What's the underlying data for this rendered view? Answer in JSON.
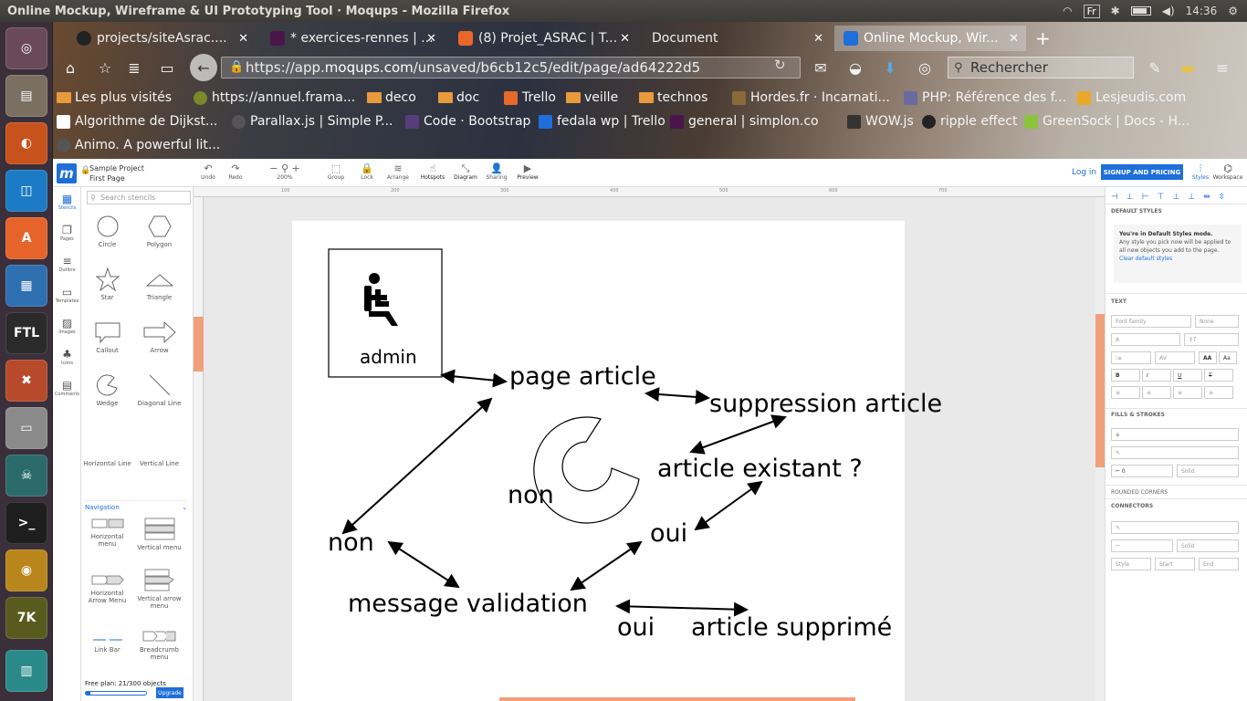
{
  "system": {
    "window_title": "Online Mockup, Wireframe & UI Prototyping Tool · Moqups - Mozilla Firefox",
    "keyboard": "Fr",
    "clock": "14:36"
  },
  "tabs": [
    {
      "label": "projects/siteAsrac...."
    },
    {
      "label": "* exercices-rennes | ..."
    },
    {
      "label": "(8) Projet_ASRAC | T..."
    },
    {
      "label": "Document"
    },
    {
      "label": "Online Mockup, Wir..."
    }
  ],
  "navbar": {
    "url_prefix": "https://app.",
    "url_domain": "moqups.com",
    "url_path": "/unsaved/b6cb12c5/edit/page/ad64222d5",
    "search_placeholder": "Rechercher"
  },
  "bookmarks_row1": [
    {
      "label": "Les plus visités"
    },
    {
      "label": "https://annuel.frama..."
    },
    {
      "label": "deco"
    },
    {
      "label": "doc"
    },
    {
      "label": "Trello"
    },
    {
      "label": "veille"
    },
    {
      "label": "technos"
    },
    {
      "label": "Hordes.fr · Incarnati..."
    },
    {
      "label": "PHP: Référence des f..."
    },
    {
      "label": "Lesjeudis.com"
    }
  ],
  "bookmarks_row2": [
    {
      "label": "Algorithme de Dijkst..."
    },
    {
      "label": "Parallax.js | Simple P..."
    },
    {
      "label": "Code · Bootstrap"
    },
    {
      "label": "fedala wp | Trello"
    },
    {
      "label": "general | simplon.co"
    },
    {
      "label": "WOW.js"
    },
    {
      "label": "ripple effect"
    },
    {
      "label": "GreenSock | Docs - H..."
    }
  ],
  "bookmarks_row3": [
    {
      "label": "Animo. A powerful lit..."
    }
  ],
  "app": {
    "project_name": "Sample Project",
    "page_name": "First Page",
    "tools": [
      "Undo",
      "Redo",
      "200%",
      "Group",
      "Lock",
      "Arrange",
      "Hotspots",
      "Diagram",
      "Sharing",
      "Preview"
    ],
    "login": "Log in",
    "signup": "SIGNUP AND PRICING",
    "right_tools": [
      "Styles",
      "Workspace"
    ],
    "side_icons": [
      "Stencils",
      "Pages",
      "Outline",
      "Templates",
      "Images",
      "Icons",
      "Comments"
    ],
    "stencil_search": "Search stencils",
    "stencils": [
      "Circle",
      "Polygon",
      "Star",
      "Triangle",
      "Callout",
      "Arrow",
      "Wedge",
      "Diagonal Line",
      "Horizontal Line",
      "Vertical Line"
    ],
    "navigation_section": "Navigation",
    "nav_stencils": [
      "Horizontal menu",
      "Vertical menu",
      "Horizontal Arrow Menu",
      "Vertical arrow menu",
      "Link Bar",
      "Breadcrumb menu"
    ],
    "free_plan": "Free plan: 21/300 objects",
    "free_plan_used": 21,
    "free_plan_limit": 300,
    "upgrade": "Upgrade",
    "ruler_ticks": [
      "100",
      "200",
      "300",
      "400",
      "500",
      "600",
      "700"
    ]
  },
  "properties": {
    "default_styles": "DEFAULT STYLES",
    "default_msg_title": "You're in Default Styles mode.",
    "default_msg_body": "Any style you pick now will be applied to all new objects you add to the page.",
    "clear_link": "Clear default styles",
    "text_section": "TEXT",
    "font_family": "Font family",
    "font_weight": "None",
    "fills_section": "FILLS & STROKES",
    "stroke_width": "0",
    "stroke_style": "Solid",
    "rounded": "ROUNDED CORNERS",
    "connectors": "CONNECTORS",
    "conn_style": "Solid",
    "conn_style_label": "Style",
    "conn_start": "Start",
    "conn_end": "End"
  },
  "diagram": {
    "admin_label": "admin",
    "labels": [
      "page article",
      "suppression article",
      "article existant ?",
      "non",
      "non",
      "oui",
      "message validation",
      "oui",
      "article supprimé"
    ]
  }
}
